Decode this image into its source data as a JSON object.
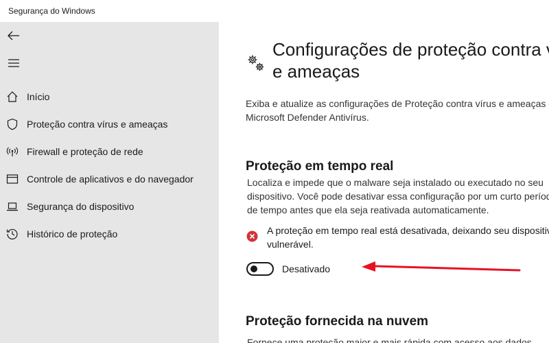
{
  "window": {
    "title": "Segurança do Windows"
  },
  "sidebar": {
    "items": [
      {
        "label": "Início",
        "icon": "home-icon"
      },
      {
        "label": "Proteção contra vírus e ameaças",
        "icon": "shield-icon"
      },
      {
        "label": "Firewall e proteção de rede",
        "icon": "wifi-antenna-icon"
      },
      {
        "label": "Controle de aplicativos e do navegador",
        "icon": "browser-window-icon"
      },
      {
        "label": "Segurança do dispositivo",
        "icon": "laptop-icon"
      },
      {
        "label": "Histórico de proteção",
        "icon": "history-icon"
      }
    ]
  },
  "main": {
    "title": "Configurações de proteção contra vírus e ameaças",
    "description": "Exiba e atualize as configurações de Proteção contra vírus e ameaças do Microsoft Defender Antivírus.",
    "realtime": {
      "heading": "Proteção em tempo real",
      "description": "Localiza e impede que o malware seja instalado ou executado no seu dispositivo. Você pode desativar essa configuração por um curto período de tempo antes que ela seja reativada automaticamente.",
      "alert": "A proteção em tempo real está desativada, deixando seu dispositivo vulnerável.",
      "toggle_label": "Desativado",
      "toggle_on": false
    },
    "cloud": {
      "heading": "Proteção fornecida na nuvem",
      "description": "Fornece uma proteção maior e mais rápida com acesso aos dados"
    }
  },
  "colors": {
    "sidebar_bg": "#e6e6e6",
    "alert_red": "#d13438",
    "annotation_arrow": "#e81123"
  }
}
